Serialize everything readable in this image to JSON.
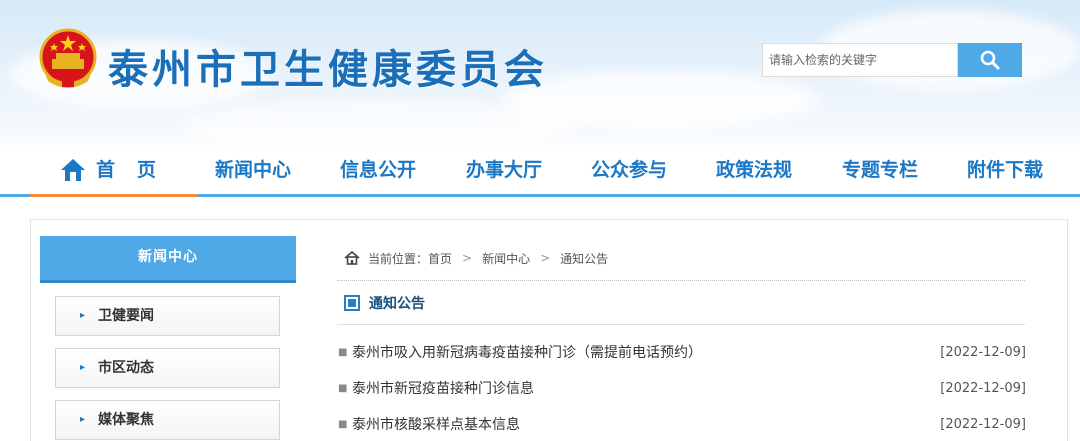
{
  "site": {
    "title": "泰州市卫生健康委员会"
  },
  "search": {
    "placeholder": "请输入检索的关键字"
  },
  "nav": {
    "items": [
      {
        "label": "首页"
      },
      {
        "label": "新闻中心"
      },
      {
        "label": "信息公开"
      },
      {
        "label": "办事大厅"
      },
      {
        "label": "公众参与"
      },
      {
        "label": "政策法规"
      },
      {
        "label": "专题专栏"
      },
      {
        "label": "附件下载"
      }
    ]
  },
  "sidebar": {
    "heading": "新闻中心",
    "items": [
      {
        "label": "卫健要闻"
      },
      {
        "label": "市区动态"
      },
      {
        "label": "媒体聚焦"
      }
    ]
  },
  "breadcrumb": {
    "prefix": "当前位置：",
    "items": [
      "首页",
      "新闻中心",
      "通知公告"
    ]
  },
  "section": {
    "title": "通知公告"
  },
  "news": [
    {
      "title": "泰州市吸入用新冠病毒疫苗接种门诊（需提前电话预约）",
      "date": "[2022-12-09]"
    },
    {
      "title": "泰州市新冠疫苗接种门诊信息",
      "date": "[2022-12-09]"
    },
    {
      "title": "泰州市核酸采样点基本信息",
      "date": "[2022-12-09]"
    }
  ],
  "colors": {
    "brand_blue": "#1b6fb8",
    "nav_blue": "#4fa9e6",
    "active_orange": "#f08c3c"
  }
}
